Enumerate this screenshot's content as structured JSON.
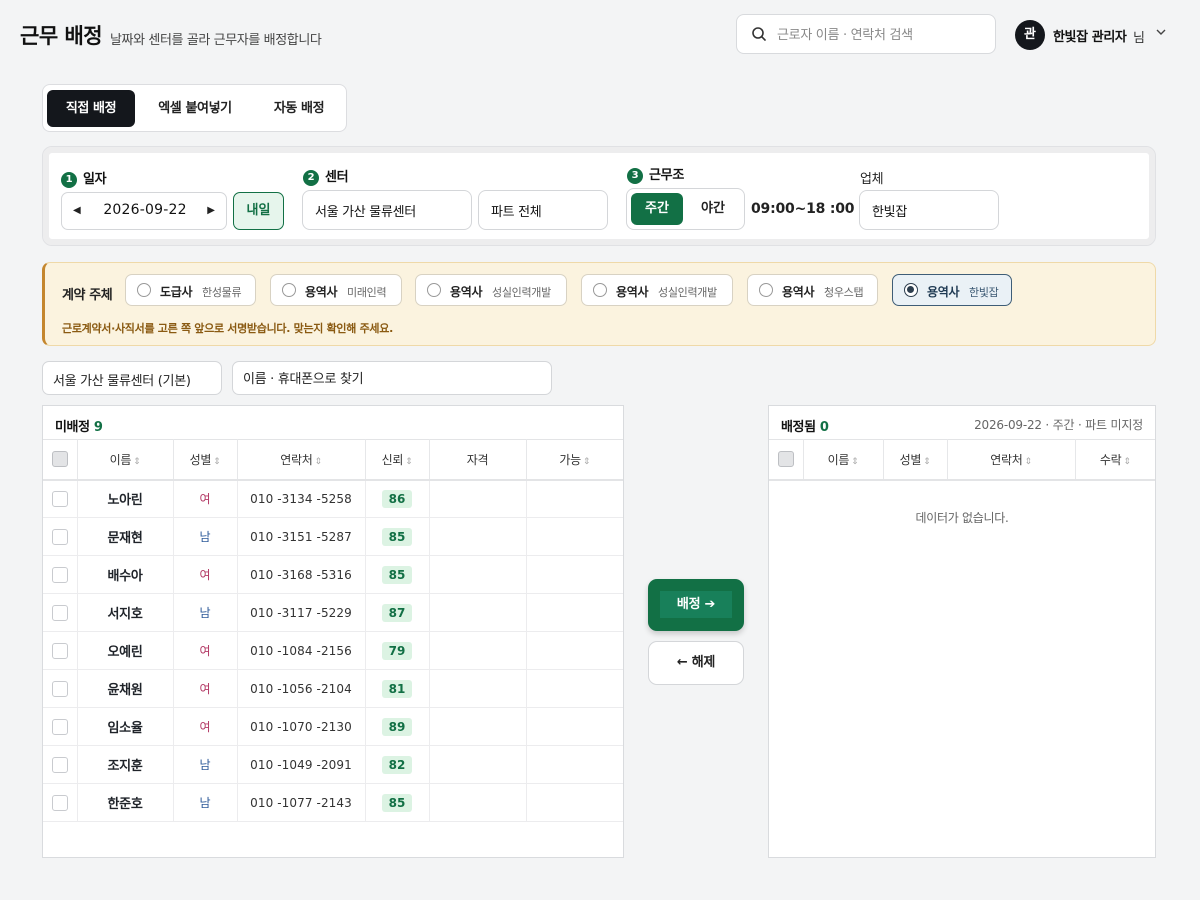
{
  "header": {
    "title": "근무 배정",
    "subtitle": "날짜와 센터를 골라 근무자를 배정합니다",
    "search_placeholder": "근로자 이름 · 연락처 검색",
    "avatar_initial": "관",
    "user_name": "한빛잡 관리자",
    "user_suffix": "님"
  },
  "mode_tabs": [
    {
      "label": "직접 배정",
      "active": true
    },
    {
      "label": "엑셀 붙여넣기",
      "active": false
    },
    {
      "label": "자동 배정",
      "active": false
    }
  ],
  "filters": {
    "date_step": "1",
    "date_label": "일자",
    "date_value": "2026-09-22",
    "tomorrow_label": "내일",
    "center_step": "2",
    "center_label": "센터",
    "center_value": "서울 가산 물류센터",
    "part_value": "파트 전체",
    "shift_step": "3",
    "shift_label": "근무조",
    "shift_day": "주간",
    "shift_night": "야간",
    "shift_time": "09:00~18 :00",
    "vendor_label": "업체",
    "vendor_value": "한빛잡"
  },
  "contract": {
    "title": "계약 주체",
    "options": [
      {
        "kind": "도급사",
        "company": "한성물류",
        "selected": false
      },
      {
        "kind": "용역사",
        "company": "미래인력",
        "selected": false
      },
      {
        "kind": "용역사",
        "company": "성실인력개발",
        "selected": false
      },
      {
        "kind": "용역사",
        "company": "성실인력개발",
        "selected": false
      },
      {
        "kind": "용역사",
        "company": "청우스탭",
        "selected": false
      },
      {
        "kind": "용역사",
        "company": "한빛잡",
        "selected": true
      }
    ],
    "note": "근로계약서·사직서를 고른 쪽 앞으로 서명받습니다. 맞는지 확인해 주세요."
  },
  "list_filters": {
    "center": "서울 가산 물류센터 (기본)",
    "search_placeholder": "이름 · 휴대폰으로 찾기"
  },
  "unassigned": {
    "title": "미배정",
    "count": "9",
    "columns": [
      "이름",
      "성별",
      "연락처",
      "신뢰",
      "자격",
      "가능"
    ],
    "rows": [
      {
        "name": "노아린",
        "gender": "여",
        "phone": "010 -3134 -5258",
        "score": "86"
      },
      {
        "name": "문재현",
        "gender": "남",
        "phone": "010 -3151 -5287",
        "score": "85"
      },
      {
        "name": "배수아",
        "gender": "여",
        "phone": "010 -3168 -5316",
        "score": "85"
      },
      {
        "name": "서지호",
        "gender": "남",
        "phone": "010 -3117  -5229",
        "score": "87"
      },
      {
        "name": "오예린",
        "gender": "여",
        "phone": "010 -1084 -2156",
        "score": "79"
      },
      {
        "name": "윤채원",
        "gender": "여",
        "phone": "010 -1056 -2104",
        "score": "81"
      },
      {
        "name": "임소율",
        "gender": "여",
        "phone": "010 -1070 -2130",
        "score": "89"
      },
      {
        "name": "조지훈",
        "gender": "남",
        "phone": "010 -1049 -2091",
        "score": "82"
      },
      {
        "name": "한준호",
        "gender": "남",
        "phone": "010 -1077 -2143",
        "score": "85"
      }
    ]
  },
  "actions": {
    "assign": "배정",
    "release": "해제"
  },
  "assigned": {
    "title": "배정됨",
    "count": "0",
    "meta": "2026-09-22 · 주간 · 파트 미지정",
    "columns": [
      "이름",
      "성별",
      "연락처",
      "수락"
    ],
    "empty": "데이터가 없습니다."
  },
  "colors": {
    "accent": "#127045",
    "dark": "#14171c",
    "warning_bg": "#fbf3df",
    "female": "#b43a66",
    "male": "#2e5b9a"
  }
}
